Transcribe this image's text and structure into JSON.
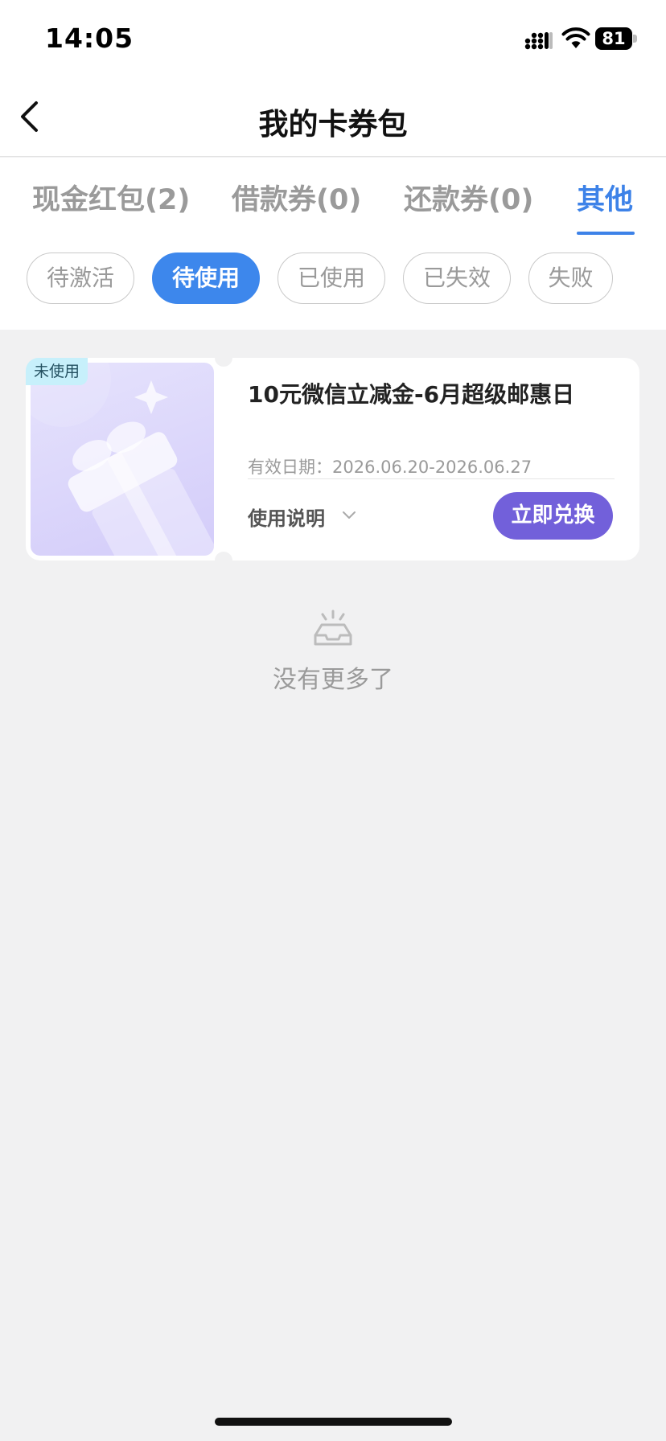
{
  "status_bar": {
    "time": "14:05",
    "battery": "81"
  },
  "header": {
    "title": "我的卡券包"
  },
  "tabs": [
    {
      "label": "现金红包(2)",
      "active": false
    },
    {
      "label": "借款券(0)",
      "active": false
    },
    {
      "label": "还款券(0)",
      "active": false
    },
    {
      "label": "其他",
      "active": true
    }
  ],
  "filters": [
    {
      "label": "待激活",
      "active": false
    },
    {
      "label": "待使用",
      "active": true
    },
    {
      "label": "已使用",
      "active": false
    },
    {
      "label": "已失效",
      "active": false
    },
    {
      "label": "失败",
      "active": false
    }
  ],
  "coupon": {
    "badge": "未使用",
    "title": "10元微信立减金-6月超级邮惠日",
    "validity_label": "有效日期：",
    "validity_range": "2026.06.20-2026.06.27",
    "usage_label": "使用说明",
    "action_label": "立即兑换",
    "image_icon": "gift-icon"
  },
  "list_end": {
    "text": "没有更多了",
    "icon": "empty-tray-icon"
  },
  "colors": {
    "accent": "#3d82e8",
    "redeem_button": "#7260da",
    "badge_bg": "#c7f0fb",
    "page_bg": "#f1f1f2"
  }
}
